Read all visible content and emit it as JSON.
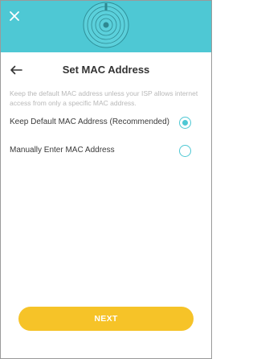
{
  "header": {
    "title": "Set MAC Address"
  },
  "description": "Keep the default MAC address unless your ISP allows internet access from only a specific MAC address.",
  "options": [
    {
      "label": "Keep Default MAC Address (Recommended)",
      "selected": true
    },
    {
      "label": "Manually Enter MAC Address",
      "selected": false
    }
  ],
  "next_button": {
    "label": "NEXT"
  },
  "icons": {
    "close": "close-icon",
    "back": "back-arrow-icon",
    "router": "router-illustration"
  },
  "colors": {
    "banner": "#4ec8d4",
    "accent": "#4ec8d4",
    "button": "#f6c328"
  }
}
